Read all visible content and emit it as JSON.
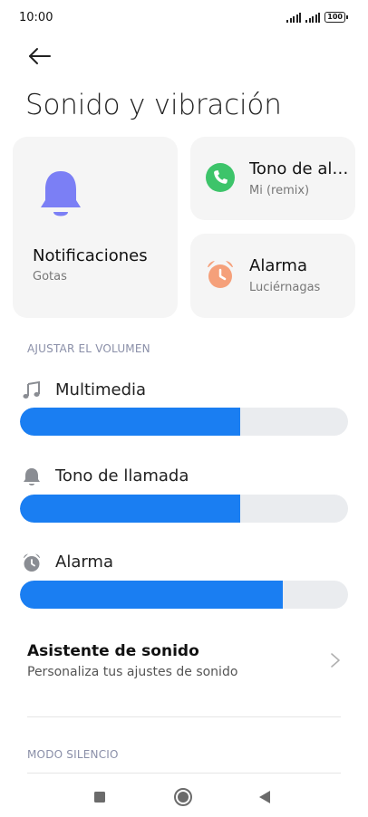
{
  "status_bar": {
    "time": "10:00",
    "battery": "100"
  },
  "header": {
    "title": "Sonido y vibración",
    "back_icon": "arrow-left-icon"
  },
  "cards": {
    "notifications": {
      "title": "Notificaciones",
      "subtitle": "Gotas",
      "icon": "bell-icon",
      "icon_color": "#7b7ff5"
    },
    "ringtone": {
      "title": "Tono de alarma",
      "subtitle": "Mi (remix)",
      "icon": "phone-icon",
      "icon_color": "#3dc46a"
    },
    "alarm": {
      "title": "Alarma",
      "subtitle": "Luciérnagas",
      "icon": "alarm-clock-icon",
      "icon_color": "#f5a07a"
    }
  },
  "volume": {
    "section_label": "AJUSTAR EL VOLUMEN",
    "items": [
      {
        "label": "Multimedia",
        "icon": "music-note-icon",
        "level": 0.67
      },
      {
        "label": "Tono de llamada",
        "icon": "bell-icon",
        "level": 0.67
      },
      {
        "label": "Alarma",
        "icon": "alarm-clock-icon",
        "level": 0.8
      }
    ],
    "accent": "#1a7ef2"
  },
  "assistant": {
    "title": "Asistente de sonido",
    "subtitle": "Personaliza tus ajustes de sonido"
  },
  "silent_mode": {
    "section_label": "MODO SILENCIO"
  },
  "nav": {
    "recents_icon": "square-icon",
    "home_icon": "circle-icon",
    "back_icon": "triangle-back-icon"
  }
}
